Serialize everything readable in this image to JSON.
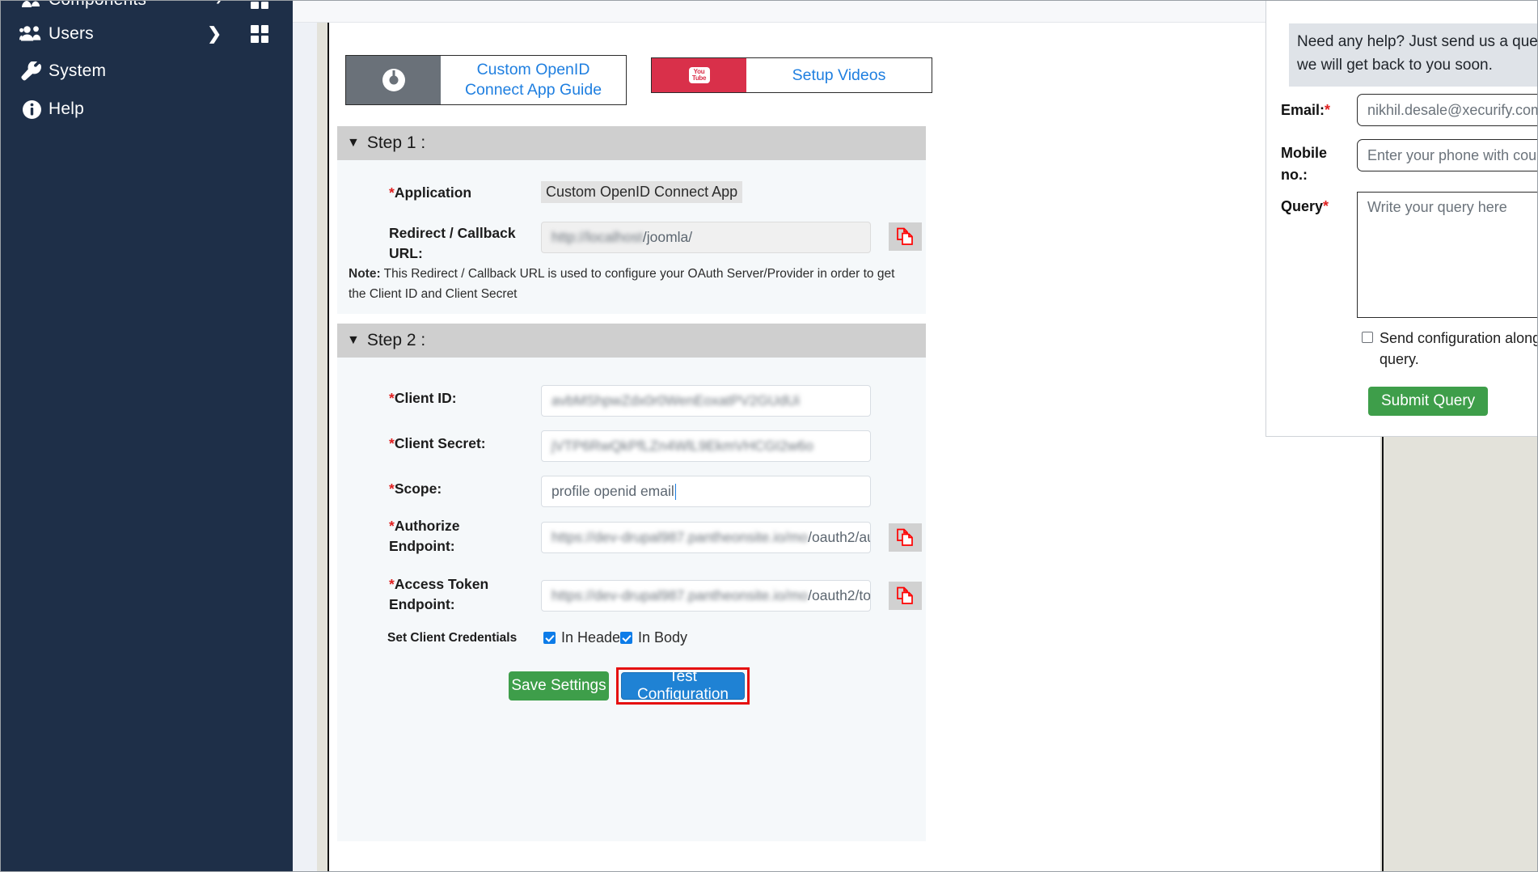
{
  "sidebar": {
    "items": [
      {
        "label": "Components",
        "icon": "components-icon",
        "has_chevron": true,
        "has_grid": true
      },
      {
        "label": "Users",
        "icon": "users-icon",
        "has_chevron": true,
        "has_grid": true
      },
      {
        "label": "System",
        "icon": "wrench-icon",
        "has_chevron": false,
        "has_grid": false
      },
      {
        "label": "Help",
        "icon": "info-icon",
        "has_chevron": false,
        "has_grid": false
      }
    ]
  },
  "guides": {
    "app_guide_label": "Custom OpenID Connect App Guide",
    "app_guide_icon": "chrome-icon",
    "videos_label": "Setup Videos",
    "videos_icon": "youtube-icon",
    "youtube_line1": "You",
    "youtube_line2": "Tube"
  },
  "step1": {
    "title": "Step 1 :",
    "caret": "▼",
    "application_label": "Application",
    "application_required": "*",
    "application_value": "Custom OpenID Connect App",
    "redirect_label": "Redirect / Callback URL:",
    "redirect_value": "http://localhost/joomla/",
    "copy_icon": "copy-icon",
    "note_prefix": "Note:",
    "note_text": " This Redirect / Callback URL is used to configure your OAuth Server/Provider in order to get the Client ID and Client Secret"
  },
  "step2": {
    "title": "Step 2 :",
    "caret": "▼",
    "client_id_label": "Client ID:",
    "client_id_value": "avbMShpwZdx0r0WenEoxatPV2GUdUi",
    "client_secret_label": "Client Secret:",
    "client_secret_value": "jVTP6RwQkPfLZn4WlL9EkmVHCGI2w6o",
    "scope_label": "Scope:",
    "scope_value": "profile openid email",
    "authorize_label": "Authorize Endpoint:",
    "authorize_value": "https://dev-drupal987.pantheonsite.io/mo/oauth2/au",
    "access_token_label": "Access Token Endpoint:",
    "access_token_value": "https://dev-drupal987.pantheonsite.io/mo/oauth2/to",
    "required_mark": "*",
    "set_credentials_label": "Set Client Credentials",
    "in_header_label": "In Header",
    "in_body_label": "In Body",
    "in_header_checked": true,
    "in_body_checked": true,
    "save_label": "Save Settings",
    "test_label": "Test Configuration",
    "copy_icon": "copy-icon"
  },
  "support": {
    "note": "Need any help? Just send us a query and we will get back to you soon.",
    "email_label": "Email:",
    "email_required": "*",
    "email_value": "nikhil.desale@xecurify.com",
    "mobile_label": "Mobile no.:",
    "mobile_placeholder": "Enter your phone with country code",
    "mobile_value": "",
    "query_label": "Query",
    "query_required": "*",
    "query_placeholder": "Write your query here",
    "query_value": "",
    "send_config_label": "Send configuration along with query.",
    "send_config_checked": false,
    "submit_label": "Submit Query"
  },
  "colors": {
    "sidebar_bg": "#1e2f48",
    "link_blue": "#1f7fe0",
    "save_green": "#3e9e4a",
    "test_blue": "#1f82d4",
    "highlight_red": "#e51010",
    "youtube_red": "#d9304a"
  }
}
